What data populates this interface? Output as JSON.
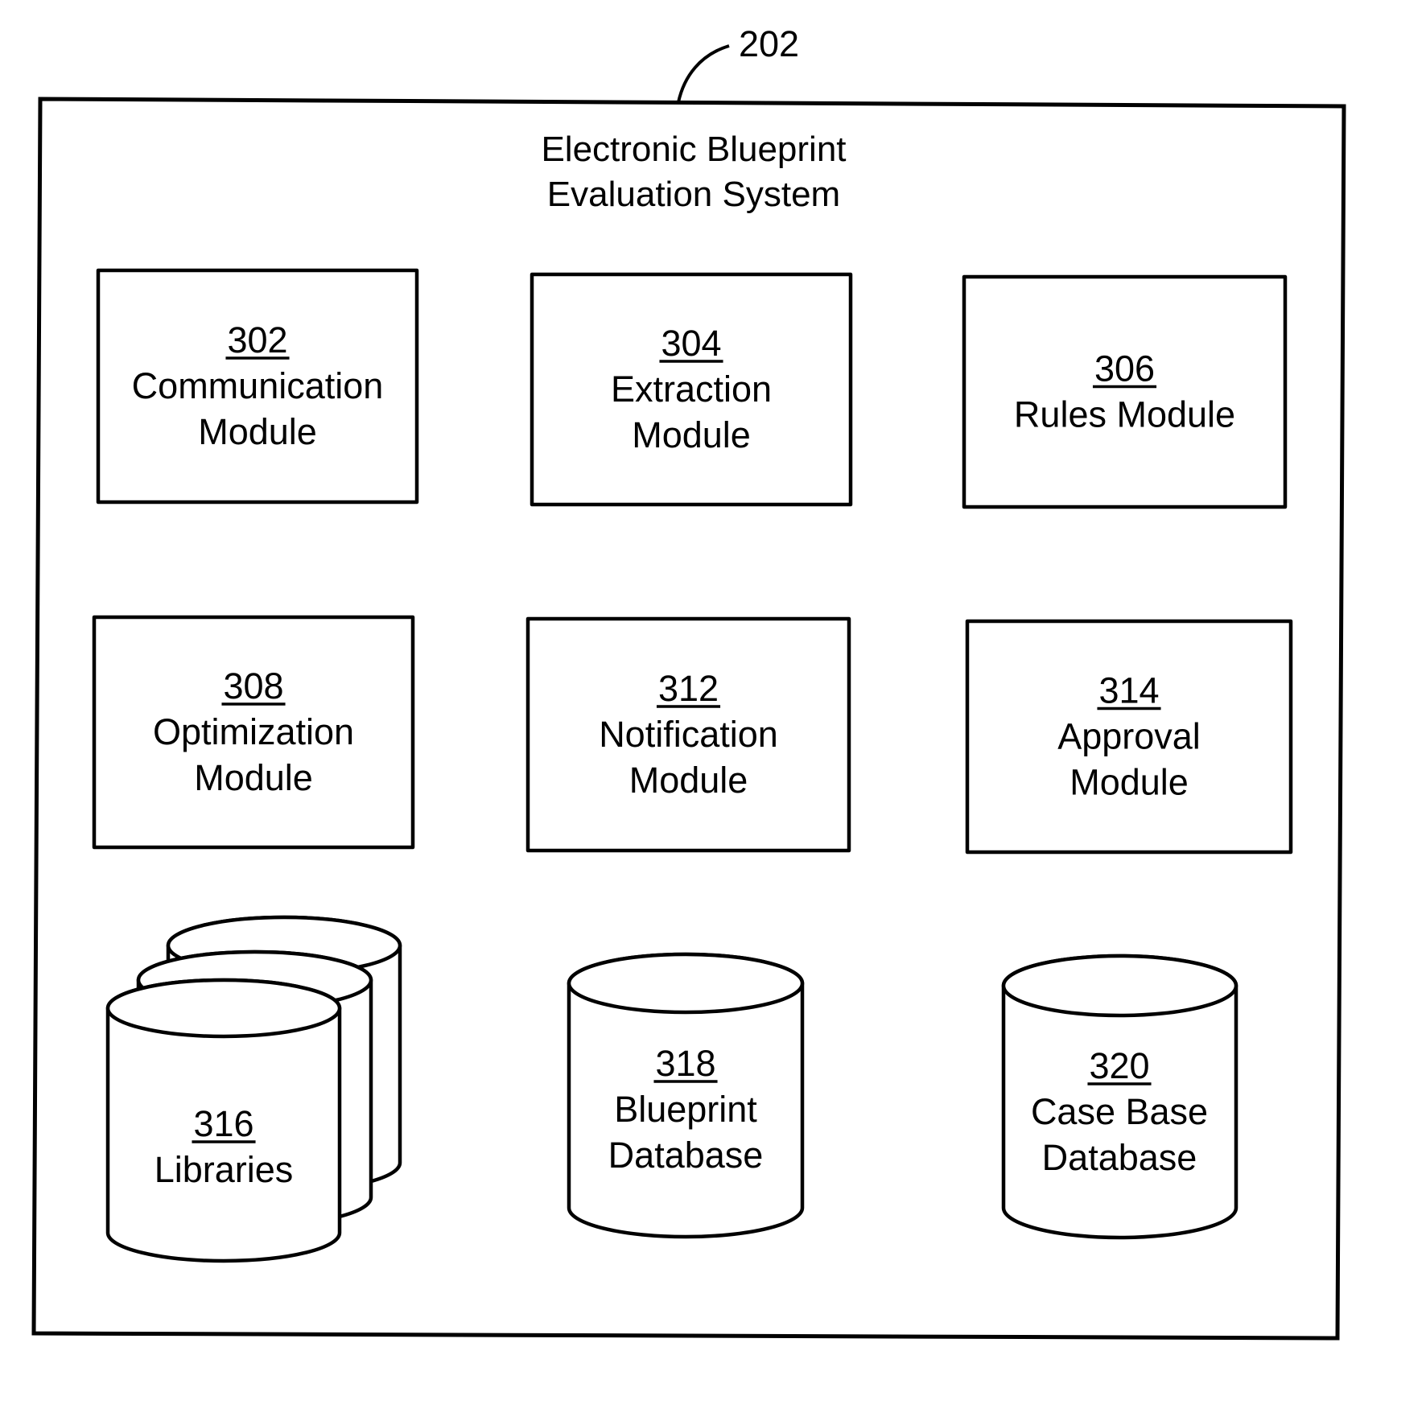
{
  "figure": {
    "reference_number": "202",
    "system_title_lines": [
      "Electronic Blueprint",
      "Evaluation System"
    ]
  },
  "modules": [
    {
      "id": "302",
      "lines": [
        "Communication",
        "Module"
      ]
    },
    {
      "id": "304",
      "lines": [
        "Extraction",
        "Module"
      ]
    },
    {
      "id": "306",
      "lines": [
        "Rules Module"
      ]
    },
    {
      "id": "308",
      "lines": [
        "Optimization",
        "Module"
      ]
    },
    {
      "id": "312",
      "lines": [
        "Notification",
        "Module"
      ]
    },
    {
      "id": "314",
      "lines": [
        "Approval",
        "Module"
      ]
    }
  ],
  "data_stores": [
    {
      "id": "316",
      "lines": [
        "Libraries"
      ],
      "stacked": true
    },
    {
      "id": "318",
      "lines": [
        "Blueprint",
        "Database"
      ],
      "stacked": false
    },
    {
      "id": "320",
      "lines": [
        "Case Base",
        "Database"
      ],
      "stacked": false
    }
  ]
}
